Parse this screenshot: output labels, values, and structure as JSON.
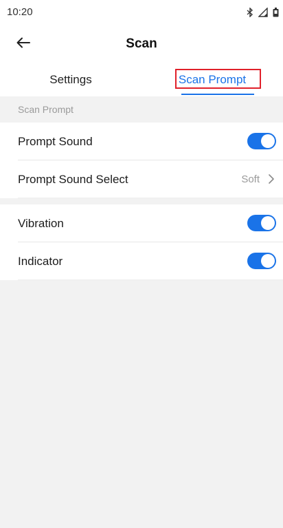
{
  "status_bar": {
    "time": "10:20",
    "icons": [
      "bluetooth-icon",
      "signal-icon",
      "battery-icon"
    ]
  },
  "header": {
    "back_icon": "arrow-left-icon",
    "title": "Scan"
  },
  "tabs": [
    {
      "label": "Settings",
      "selected": false
    },
    {
      "label": "Scan Prompt",
      "selected": true
    }
  ],
  "section": {
    "label": "Scan Prompt"
  },
  "group1": {
    "items": [
      {
        "label": "Prompt Sound",
        "type": "toggle",
        "on": true
      },
      {
        "label": "Prompt Sound Select",
        "type": "select",
        "value": "Soft"
      }
    ]
  },
  "group2": {
    "items": [
      {
        "label": "Vibration",
        "type": "toggle",
        "on": true
      },
      {
        "label": "Indicator",
        "type": "toggle",
        "on": true
      }
    ]
  },
  "colors": {
    "accent": "#1a73e8",
    "highlight_box": "#e0202a",
    "background": "#f2f2f2"
  }
}
